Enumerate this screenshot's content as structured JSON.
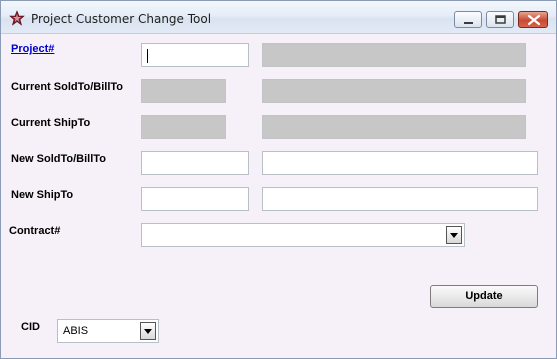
{
  "window": {
    "title": "Project Customer Change Tool"
  },
  "form": {
    "project_label": "Project#",
    "current_soldto_label": "Current SoldTo/BillTo",
    "current_shipto_label": "Current ShipTo",
    "new_soldto_label": "New SoldTo/BillTo",
    "new_shipto_label": "New ShipTo",
    "contract_label": "Contract#",
    "contract_value": "",
    "cid_label": "CID",
    "cid_value": "ABIS",
    "update_label": "Update"
  },
  "colors": {
    "window_bg": "#f6f1f8",
    "disabled_field": "#c7c7c7",
    "link": "#0000cc",
    "icon_star": "#8b1a2e"
  }
}
